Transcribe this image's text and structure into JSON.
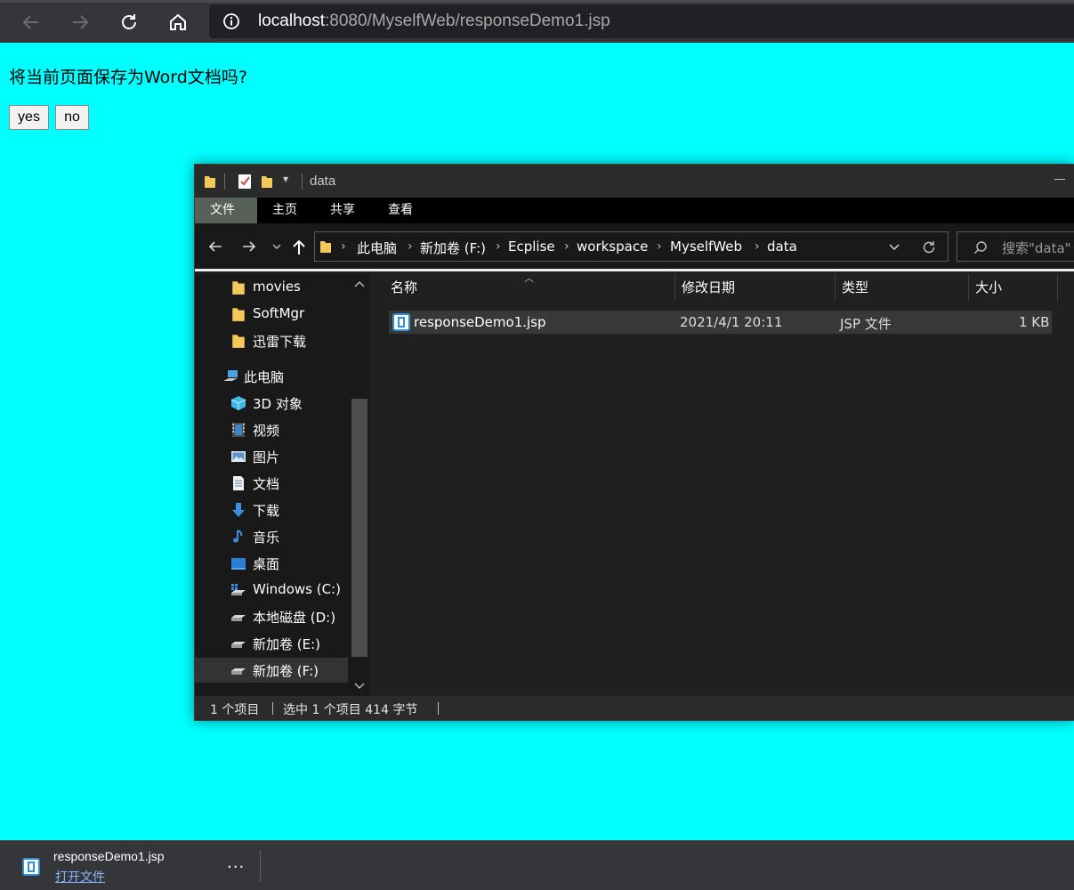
{
  "browser": {
    "url_host": "localhost",
    "url_path": ":8080/MyselfWeb/responseDemo1.jsp",
    "icons": [
      "back-arrow-icon",
      "forward-arrow-icon",
      "reload-icon",
      "home-icon",
      "info-icon"
    ]
  },
  "page": {
    "question": "将当前页面保存为Word文档吗?",
    "yes_label": "yes",
    "no_label": "no",
    "background": "#00ffff"
  },
  "explorer": {
    "title": "data",
    "ribbon_tabs": [
      "文件",
      "主页",
      "共享",
      "查看"
    ],
    "breadcrumb": [
      "此电脑",
      "新加卷 (F:)",
      "Ecplise",
      "workspace",
      "MyselfWeb",
      "data"
    ],
    "search_placeholder": "搜索\"data\"",
    "sidebar": [
      {
        "label": "movies",
        "icon": "folder-icon"
      },
      {
        "label": "SoftMgr",
        "icon": "folder-icon"
      },
      {
        "label": "迅雷下载",
        "icon": "folder-icon"
      },
      {
        "label": "此电脑",
        "icon": "computer-icon"
      },
      {
        "label": "3D 对象",
        "icon": "3d-objects-icon"
      },
      {
        "label": "视频",
        "icon": "video-icon"
      },
      {
        "label": "图片",
        "icon": "pictures-icon"
      },
      {
        "label": "文档",
        "icon": "documents-icon"
      },
      {
        "label": "下载",
        "icon": "download-icon"
      },
      {
        "label": "音乐",
        "icon": "music-icon"
      },
      {
        "label": "桌面",
        "icon": "desktop-icon"
      },
      {
        "label": "Windows (C:)",
        "icon": "drive-icon"
      },
      {
        "label": "本地磁盘 (D:)",
        "icon": "drive-icon"
      },
      {
        "label": "新加卷 (E:)",
        "icon": "drive-icon"
      },
      {
        "label": "新加卷 (F:)",
        "icon": "drive-icon"
      }
    ],
    "columns": [
      "名称",
      "修改日期",
      "类型",
      "大小"
    ],
    "files": [
      {
        "name": "responseDemo1.jsp",
        "modified": "2021/4/1 20:11",
        "type": "JSP 文件",
        "size": "1 KB"
      }
    ],
    "status": {
      "count": "1 个项目",
      "selection": "选中 1 个项目  414 字节"
    }
  },
  "download": {
    "filename": "responseDemo1.jsp",
    "open_label": "打开文件",
    "more_label": "..."
  }
}
